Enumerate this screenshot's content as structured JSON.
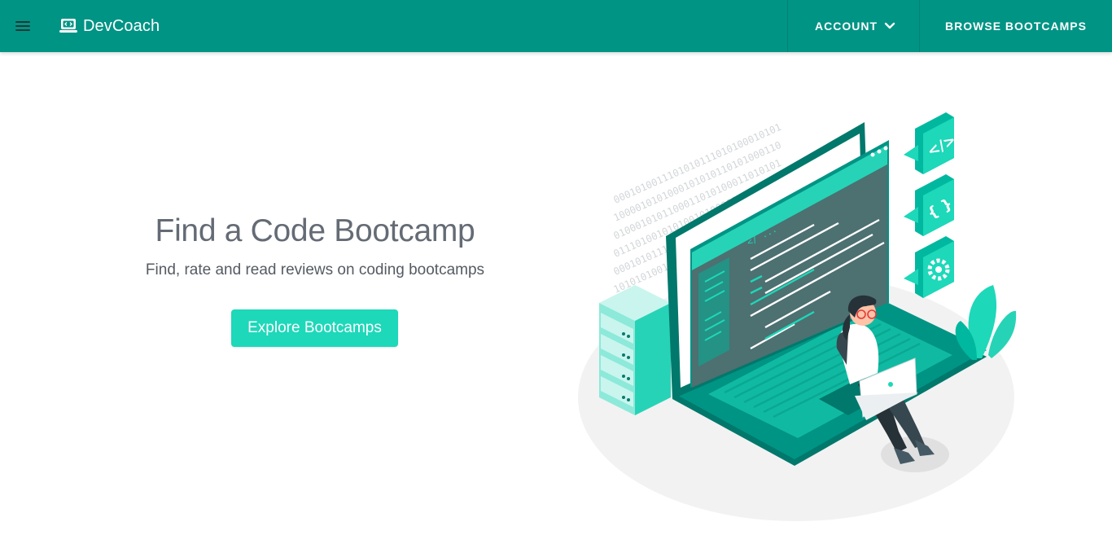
{
  "navbar": {
    "brand": "DevCoach",
    "account_label": "ACCOUNT",
    "browse_label": "BROWSE BOOTCAMPS",
    "menu_icon": "hamburger-menu-icon",
    "brand_icon": "laptop-code-icon",
    "account_icon": "chevron-down-icon"
  },
  "hero": {
    "title": "Find a Code Bootcamp",
    "subtitle": "Find, rate and read reviews on coding bootcamps",
    "button_label": "Explore Bootcamps"
  },
  "illustration": {
    "code_tag": "</>",
    "braces": "{ }",
    "comment": "</ ...",
    "binary_lines": [
      "0001010011101010111010100010101",
      "1000010101000101010110101000110",
      "0100010101100011010100011010101",
      "0111010010101001010001011010101",
      "0001010111001011101010101010101",
      "1010101001010101010101000101010"
    ]
  },
  "colors": {
    "navbar": "#009485",
    "accent": "#1dd8b9",
    "dark_teal": "#00786b",
    "title": "#646b75"
  }
}
